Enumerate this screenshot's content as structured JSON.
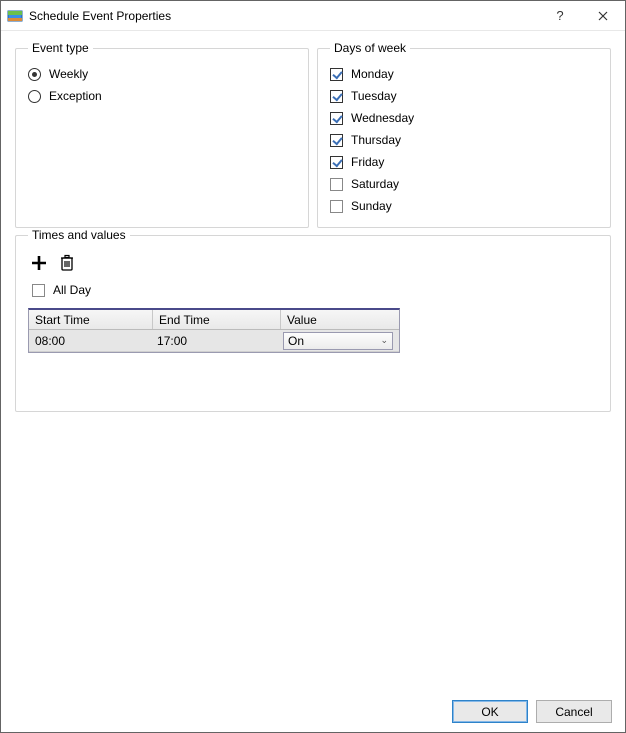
{
  "window": {
    "title": "Schedule Event Properties"
  },
  "event_type": {
    "legend": "Event type",
    "options": [
      {
        "label": "Weekly",
        "checked": true
      },
      {
        "label": "Exception",
        "checked": false
      }
    ]
  },
  "days_of_week": {
    "legend": "Days of week",
    "items": [
      {
        "label": "Monday",
        "checked": true
      },
      {
        "label": "Tuesday",
        "checked": true
      },
      {
        "label": "Wednesday",
        "checked": true
      },
      {
        "label": "Thursday",
        "checked": true
      },
      {
        "label": "Friday",
        "checked": true
      },
      {
        "label": "Saturday",
        "checked": false
      },
      {
        "label": "Sunday",
        "checked": false
      }
    ]
  },
  "times_values": {
    "legend": "Times and values",
    "all_day_label": "All Day",
    "all_day_checked": false,
    "columns": {
      "start": "Start Time",
      "end": "End Time",
      "value": "Value"
    },
    "rows": [
      {
        "start": "08:00",
        "end": "17:00",
        "value": "On"
      }
    ]
  },
  "buttons": {
    "ok": "OK",
    "cancel": "Cancel"
  }
}
